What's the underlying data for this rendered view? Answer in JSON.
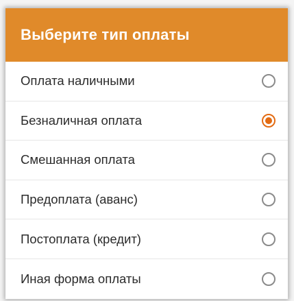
{
  "dialog": {
    "title": "Выберите тип оплаты",
    "accent_color": "#e08a2a",
    "radio_checked_color": "#e36b12"
  },
  "options": [
    {
      "label": "Оплата наличными",
      "selected": false
    },
    {
      "label": "Безналичная оплата",
      "selected": true
    },
    {
      "label": "Смешанная оплата",
      "selected": false
    },
    {
      "label": "Предоплата (аванс)",
      "selected": false
    },
    {
      "label": "Постоплата (кредит)",
      "selected": false
    },
    {
      "label": "Иная форма оплаты",
      "selected": false
    }
  ]
}
